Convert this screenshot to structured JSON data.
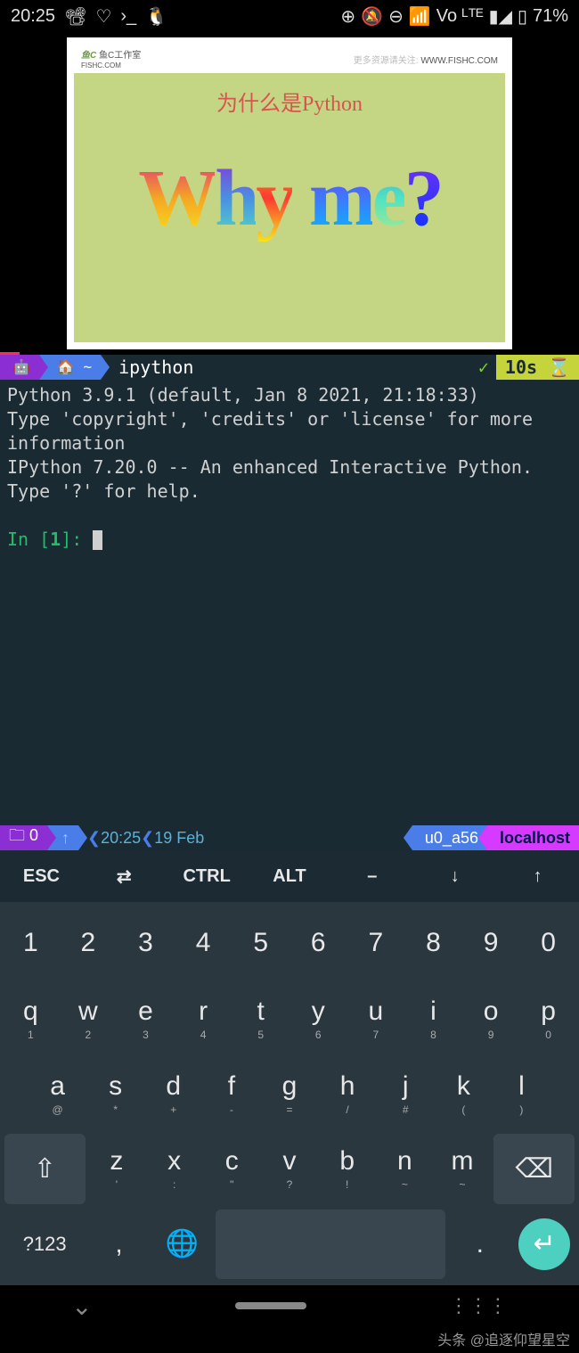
{
  "status": {
    "time": "20:25",
    "battery": "71%",
    "icons": [
      "Fc",
      "♡",
      "›_",
      "Ω"
    ],
    "right_icons": [
      "⊕",
      "🔕",
      "⊖",
      "📶₅",
      "Vo",
      "ᴸᵀᴱ",
      "📶",
      "🔋"
    ]
  },
  "slide": {
    "logo_text": "鱼C工作室",
    "logo_url": "FISHC.COM",
    "header_right": "更多资源请关注:",
    "header_url": "WWW.FISHC.COM",
    "title": "为什么是Python",
    "main_text": "Why me?"
  },
  "terminal": {
    "tab_title": "ipython",
    "timer": "10s",
    "line1": "Python 3.9.1 (default, Jan  8 2021, 21:18:33)",
    "line2": "Type 'copyright', 'credits' or 'license' for more information",
    "line3": "IPython 7.20.0 -- An enhanced Interactive Python. Type '?' for help.",
    "prompt": "In [1]: ",
    "status_disk": "🗀 0",
    "status_up": "↑",
    "status_time": "20:25",
    "status_date": "19 Feb",
    "status_user": "u0_a56",
    "status_host": "localhost"
  },
  "toolbar": {
    "keys": [
      "ESC",
      "⇄",
      "CTRL",
      "ALT",
      "–",
      "↓",
      "↑"
    ]
  },
  "keyboard": {
    "row_num": [
      "1",
      "2",
      "3",
      "4",
      "5",
      "6",
      "7",
      "8",
      "9",
      "0"
    ],
    "row_q": [
      {
        "k": "q",
        "s": "1"
      },
      {
        "k": "w",
        "s": "2"
      },
      {
        "k": "e",
        "s": "3"
      },
      {
        "k": "r",
        "s": "4"
      },
      {
        "k": "t",
        "s": "5"
      },
      {
        "k": "y",
        "s": "6"
      },
      {
        "k": "u",
        "s": "7"
      },
      {
        "k": "i",
        "s": "8"
      },
      {
        "k": "o",
        "s": "9"
      },
      {
        "k": "p",
        "s": "0"
      }
    ],
    "row_a": [
      {
        "k": "a",
        "s": "@"
      },
      {
        "k": "s",
        "s": "*"
      },
      {
        "k": "d",
        "s": "+"
      },
      {
        "k": "f",
        "s": "-"
      },
      {
        "k": "g",
        "s": "="
      },
      {
        "k": "h",
        "s": "/"
      },
      {
        "k": "j",
        "s": "#"
      },
      {
        "k": "k",
        "s": "("
      },
      {
        "k": "l",
        "s": ")"
      }
    ],
    "row_z": [
      {
        "k": "z",
        "s": "'"
      },
      {
        "k": "x",
        "s": ":"
      },
      {
        "k": "c",
        "s": "\""
      },
      {
        "k": "v",
        "s": "?"
      },
      {
        "k": "b",
        "s": "!"
      },
      {
        "k": "n",
        "s": "~"
      },
      {
        "k": "m",
        "s": "~"
      }
    ],
    "sym": "?123",
    "comma": ",",
    "globe": "🌐",
    "period": ".",
    "enter": "↩"
  },
  "watermark": "头条 @追逐仰望星空"
}
